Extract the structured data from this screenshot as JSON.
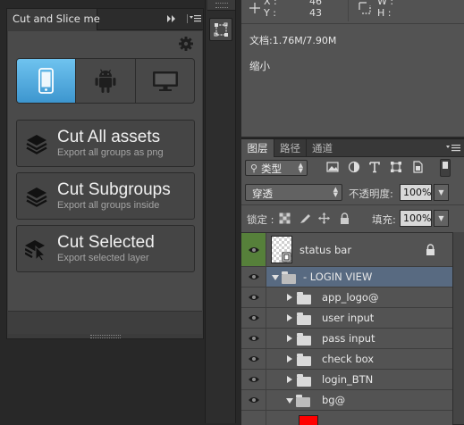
{
  "slice_panel": {
    "tab_title": "Cut and Slice me",
    "platforms": [
      {
        "name": "ios",
        "icon": "phone-icon",
        "selected": true
      },
      {
        "name": "android",
        "icon": "android-icon",
        "selected": false
      },
      {
        "name": "desktop",
        "icon": "monitor-icon",
        "selected": false
      }
    ],
    "buttons": [
      {
        "title": "Cut All assets",
        "subtitle": "Export all groups as png",
        "icon": "layers-stack-icon"
      },
      {
        "title": "Cut Subgroups",
        "subtitle": "Export all groups inside",
        "icon": "layers-stack-icon"
      },
      {
        "title": "Cut Selected",
        "subtitle": "Export selected layer",
        "icon": "layers-cursor-icon"
      }
    ],
    "accent_color": "#4aa7df"
  },
  "info_panel": {
    "x_label": "X :",
    "x_value": "46",
    "y_label": "Y :",
    "y_value": "43",
    "w_label": "W :",
    "h_label": "H :",
    "doc_size": "文档:1.76M/7.90M",
    "zoom_text": "缩小"
  },
  "layers_panel": {
    "tabs": [
      "图层",
      "路径",
      "通道"
    ],
    "filter_type": "类型",
    "blend_mode": "穿透",
    "opacity_label": "不透明度:",
    "opacity_value": "100%",
    "lock_label": "锁定 :",
    "fill_label": "填充:",
    "fill_value": "100%",
    "layers": [
      {
        "name": "status bar",
        "kind": "smart-object",
        "visible": true,
        "locked": true
      },
      {
        "name": "- LOGIN VIEW",
        "kind": "group",
        "expanded": true,
        "selected": true,
        "visible": true
      },
      {
        "name": "app_logo@",
        "kind": "group",
        "expanded": false,
        "visible": true
      },
      {
        "name": "user input",
        "kind": "group",
        "expanded": false,
        "visible": true
      },
      {
        "name": "pass input",
        "kind": "group",
        "expanded": false,
        "visible": true
      },
      {
        "name": "check box",
        "kind": "group",
        "expanded": false,
        "visible": true
      },
      {
        "name": "login_BTN",
        "kind": "group",
        "expanded": false,
        "visible": true
      },
      {
        "name": "bg@",
        "kind": "group",
        "expanded": true,
        "visible": true
      }
    ],
    "selected_row_color": "#586a81",
    "visible_highlight_color": "#56803a",
    "bg_layer_swatch": "#ff0000"
  }
}
